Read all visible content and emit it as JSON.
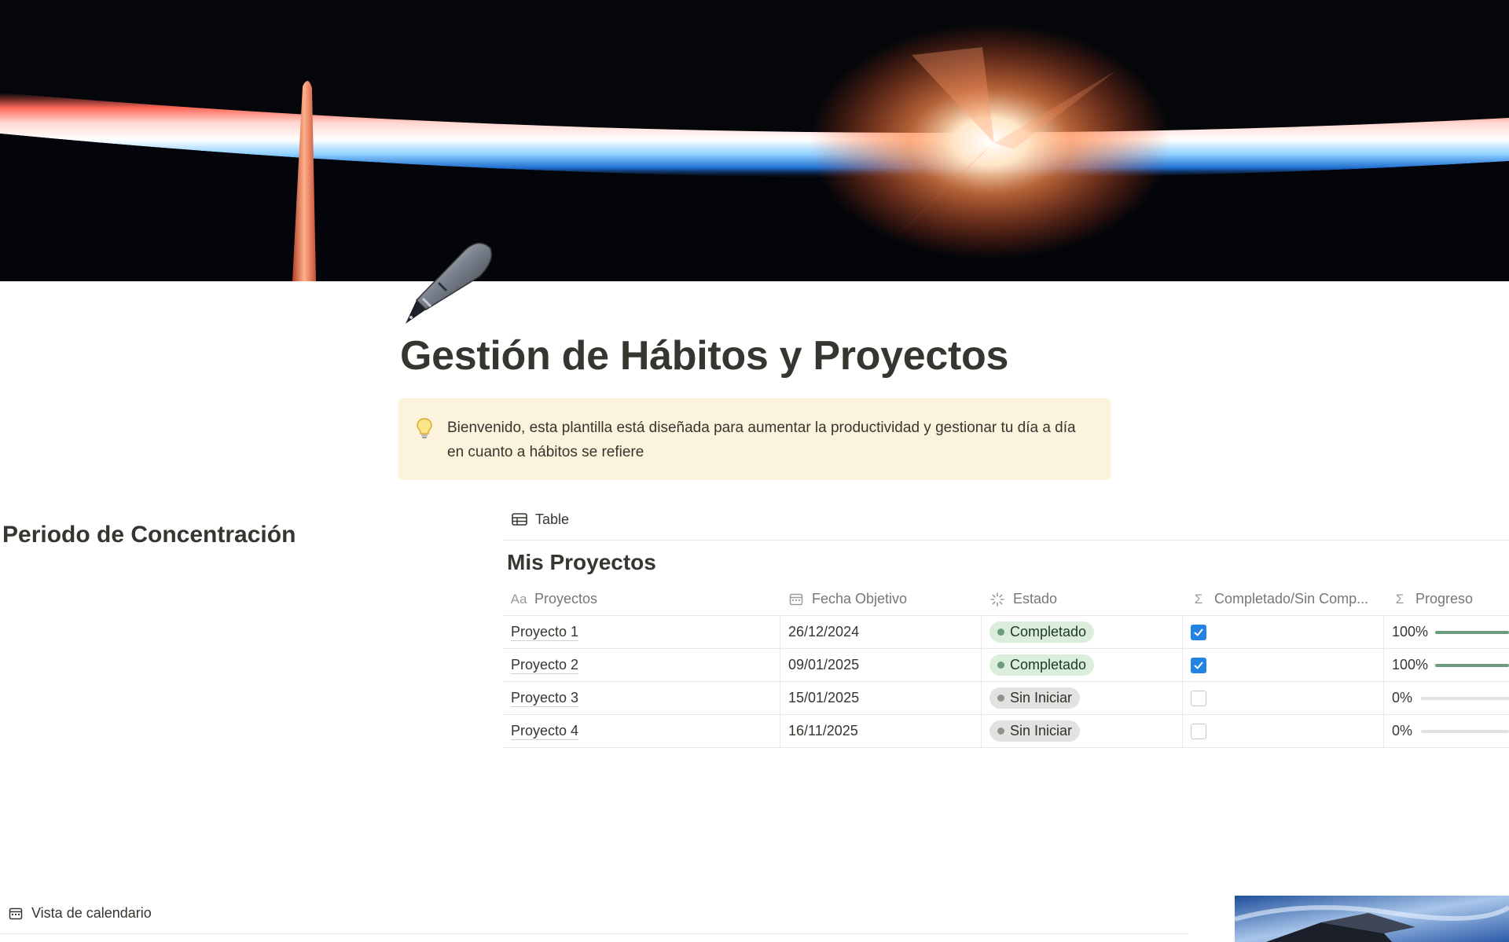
{
  "page": {
    "title": "Gestión de Hábitos y Proyectos",
    "icon": "fountain-pen-icon",
    "cover": "earth-horizon-sunrise-image"
  },
  "callout": {
    "icon": "lightbulb-icon",
    "text": "Bienvenido, esta plantilla está diseñada para aumentar la productividad y gestionar tu día a día en cuanto a hábitos se refiere"
  },
  "side_heading": "Periodo de Concentración",
  "database": {
    "view_tab": "Table",
    "title": "Mis Proyectos",
    "columns": [
      {
        "label": "Proyectos",
        "icon": "Aa"
      },
      {
        "label": "Fecha Objetivo",
        "icon": "calendar-icon"
      },
      {
        "label": "Estado",
        "icon": "status-icon"
      },
      {
        "label": "Completado/Sin Comp...",
        "icon": "sigma-icon"
      },
      {
        "label": "Progreso",
        "icon": "sigma-icon"
      }
    ],
    "rows": [
      {
        "name": "Proyecto 1",
        "date": "26/12/2024",
        "status": "Completado",
        "completed": true,
        "progress_label": "100%",
        "progress": 1.0
      },
      {
        "name": "Proyecto 2",
        "date": "09/01/2025",
        "status": "Completado",
        "completed": true,
        "progress_label": "100%",
        "progress": 1.0
      },
      {
        "name": "Proyecto 3",
        "date": "15/01/2025",
        "status": "Sin Iniciar",
        "completed": false,
        "progress_label": "0%",
        "progress": 0.0
      },
      {
        "name": "Proyecto 4",
        "date": "16/11/2025",
        "status": "Sin Iniciar",
        "completed": false,
        "progress_label": "0%",
        "progress": 0.0
      }
    ]
  },
  "calendar": {
    "view_tab": "Vista de calendario"
  },
  "colors": {
    "accent_blue": "#2383e2",
    "status_done_bg": "#dbeddb",
    "status_todo_bg": "#e3e2e0",
    "callout_bg": "#fbf3db",
    "progress_green": "#6c9b7d"
  }
}
